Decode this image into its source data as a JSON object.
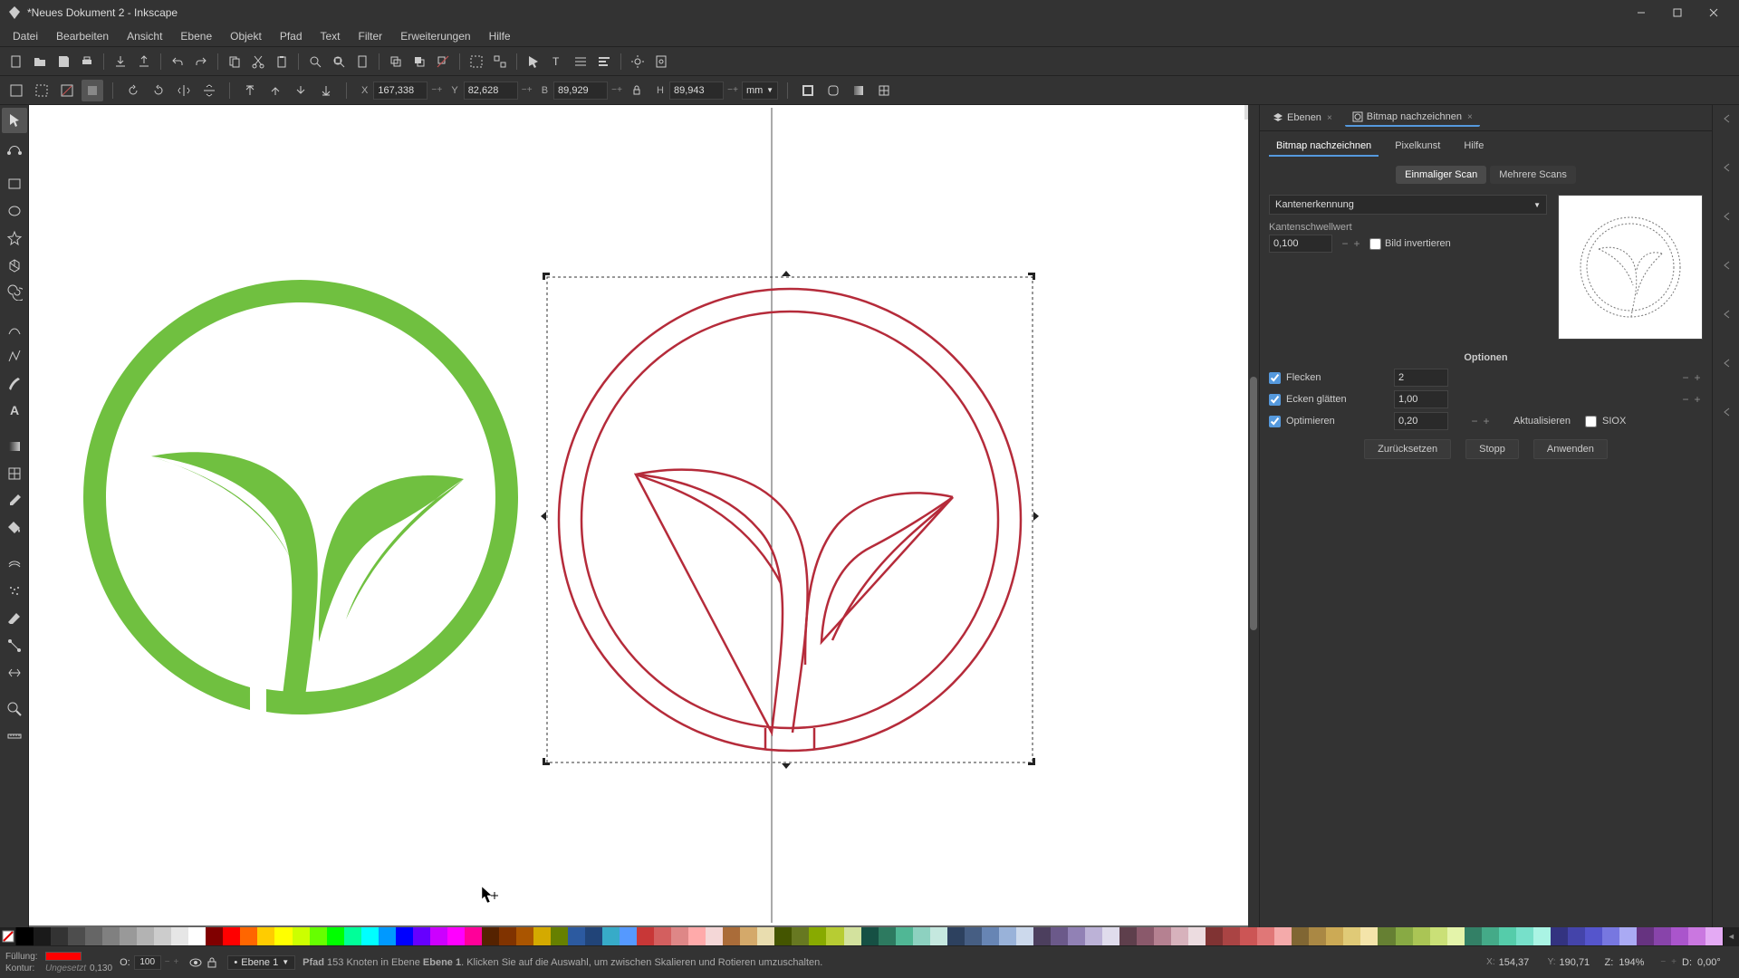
{
  "title": "*Neues Dokument 2 - Inkscape",
  "menu": [
    "Datei",
    "Bearbeiten",
    "Ansicht",
    "Ebene",
    "Objekt",
    "Pfad",
    "Text",
    "Filter",
    "Erweiterungen",
    "Hilfe"
  ],
  "coords": {
    "x_label": "X",
    "x": "167,338",
    "y_label": "Y",
    "y": "82,628",
    "w_label": "B",
    "w": "89,929",
    "h_label": "H",
    "h": "89,943",
    "unit": "mm"
  },
  "dock": {
    "tab_layers": "Ebenen",
    "tab_trace": "Bitmap nachzeichnen"
  },
  "trace": {
    "tab_trace": "Bitmap nachzeichnen",
    "tab_pixel": "Pixelkunst",
    "tab_help": "Hilfe",
    "single_scan": "Einmaliger Scan",
    "multi_scans": "Mehrere Scans",
    "detection_mode": "Kantenerkennung",
    "threshold_label": "Kantenschwellwert",
    "threshold_value": "0,100",
    "invert_label": "Bild invertieren",
    "options_title": "Optionen",
    "opt_speckles": "Flecken",
    "opt_speckles_val": "2",
    "opt_smooth": "Ecken glätten",
    "opt_smooth_val": "1,00",
    "opt_optimize": "Optimieren",
    "opt_optimize_val": "0,20",
    "btn_update": "Aktualisieren",
    "siox_label": "SIOX",
    "btn_reset": "Zurücksetzen",
    "btn_stop": "Stopp",
    "btn_apply": "Anwenden"
  },
  "status": {
    "fill_label": "Füllung:",
    "stroke_label": "Kontur:",
    "stroke_text": "Ungesetzt",
    "stroke_width": "0,130",
    "opacity_label": "O:",
    "opacity_value": "100",
    "layer_sel": "Ebene 1",
    "hint_prefix": "Pfad",
    "hint_nodes": "153",
    "hint_mid1": "Knoten in Ebene",
    "hint_layer": "Ebene 1",
    "hint_rest": ". Klicken Sie auf die Auswahl, um zwischen Skalieren und Rotieren umzuschalten.",
    "cursor_x_label": "X:",
    "cursor_x": "154,37",
    "cursor_y_label": "Y:",
    "cursor_y": "190,71",
    "zoom_label": "Z:",
    "zoom_val": "194%",
    "rot_label": "D:",
    "rot_val": "0,00°"
  },
  "palette": [
    "#000000",
    "#1a1a1a",
    "#333333",
    "#4d4d4d",
    "#666666",
    "#808080",
    "#999999",
    "#b3b3b3",
    "#cccccc",
    "#e6e6e6",
    "#ffffff",
    "#800000",
    "#ff0000",
    "#ff6600",
    "#ffcc00",
    "#ffff00",
    "#ccff00",
    "#66ff00",
    "#00ff00",
    "#00ff99",
    "#00ffff",
    "#0099ff",
    "#0000ff",
    "#6600ff",
    "#cc00ff",
    "#ff00ff",
    "#ff0099",
    "#552200",
    "#803300",
    "#aa5500",
    "#d4aa00",
    "#668000",
    "#2c5aa0",
    "#214478",
    "#37abc8",
    "#5599ff",
    "#c83737",
    "#d35f5f",
    "#de8787",
    "#ffaaaa",
    "#f4d7d7",
    "#aa6c39",
    "#d4a96a",
    "#e9ddaf",
    "#445500",
    "#677821",
    "#88aa00",
    "#b7cc33",
    "#d3e29e",
    "#165044",
    "#2d7a60",
    "#50b795",
    "#8dd1c0",
    "#c5e8df",
    "#2d415f",
    "#465e83",
    "#6785b4",
    "#99b2d9",
    "#ccd9ec",
    "#4c3f5e",
    "#6b598a",
    "#9181b5",
    "#bcb2d7",
    "#e0dcec",
    "#5e3f4c",
    "#8a596b",
    "#b58191",
    "#d7b2bc",
    "#ecdce0",
    "#803333",
    "#aa4444",
    "#cc5555",
    "#e07777",
    "#f4aaaa",
    "#806633",
    "#aa8844",
    "#ccaa55",
    "#e0ca77",
    "#f4e4aa",
    "#668033",
    "#88aa44",
    "#aac555",
    "#cae077",
    "#e4f4aa",
    "#338066",
    "#44aa88",
    "#55ccaa",
    "#77e0ca",
    "#aaf4e4",
    "#333380",
    "#4444aa",
    "#5555cc",
    "#7777e0",
    "#aaaaf4",
    "#663380",
    "#8844aa",
    "#aa55cc",
    "#ca77e0",
    "#e4aaf4"
  ]
}
